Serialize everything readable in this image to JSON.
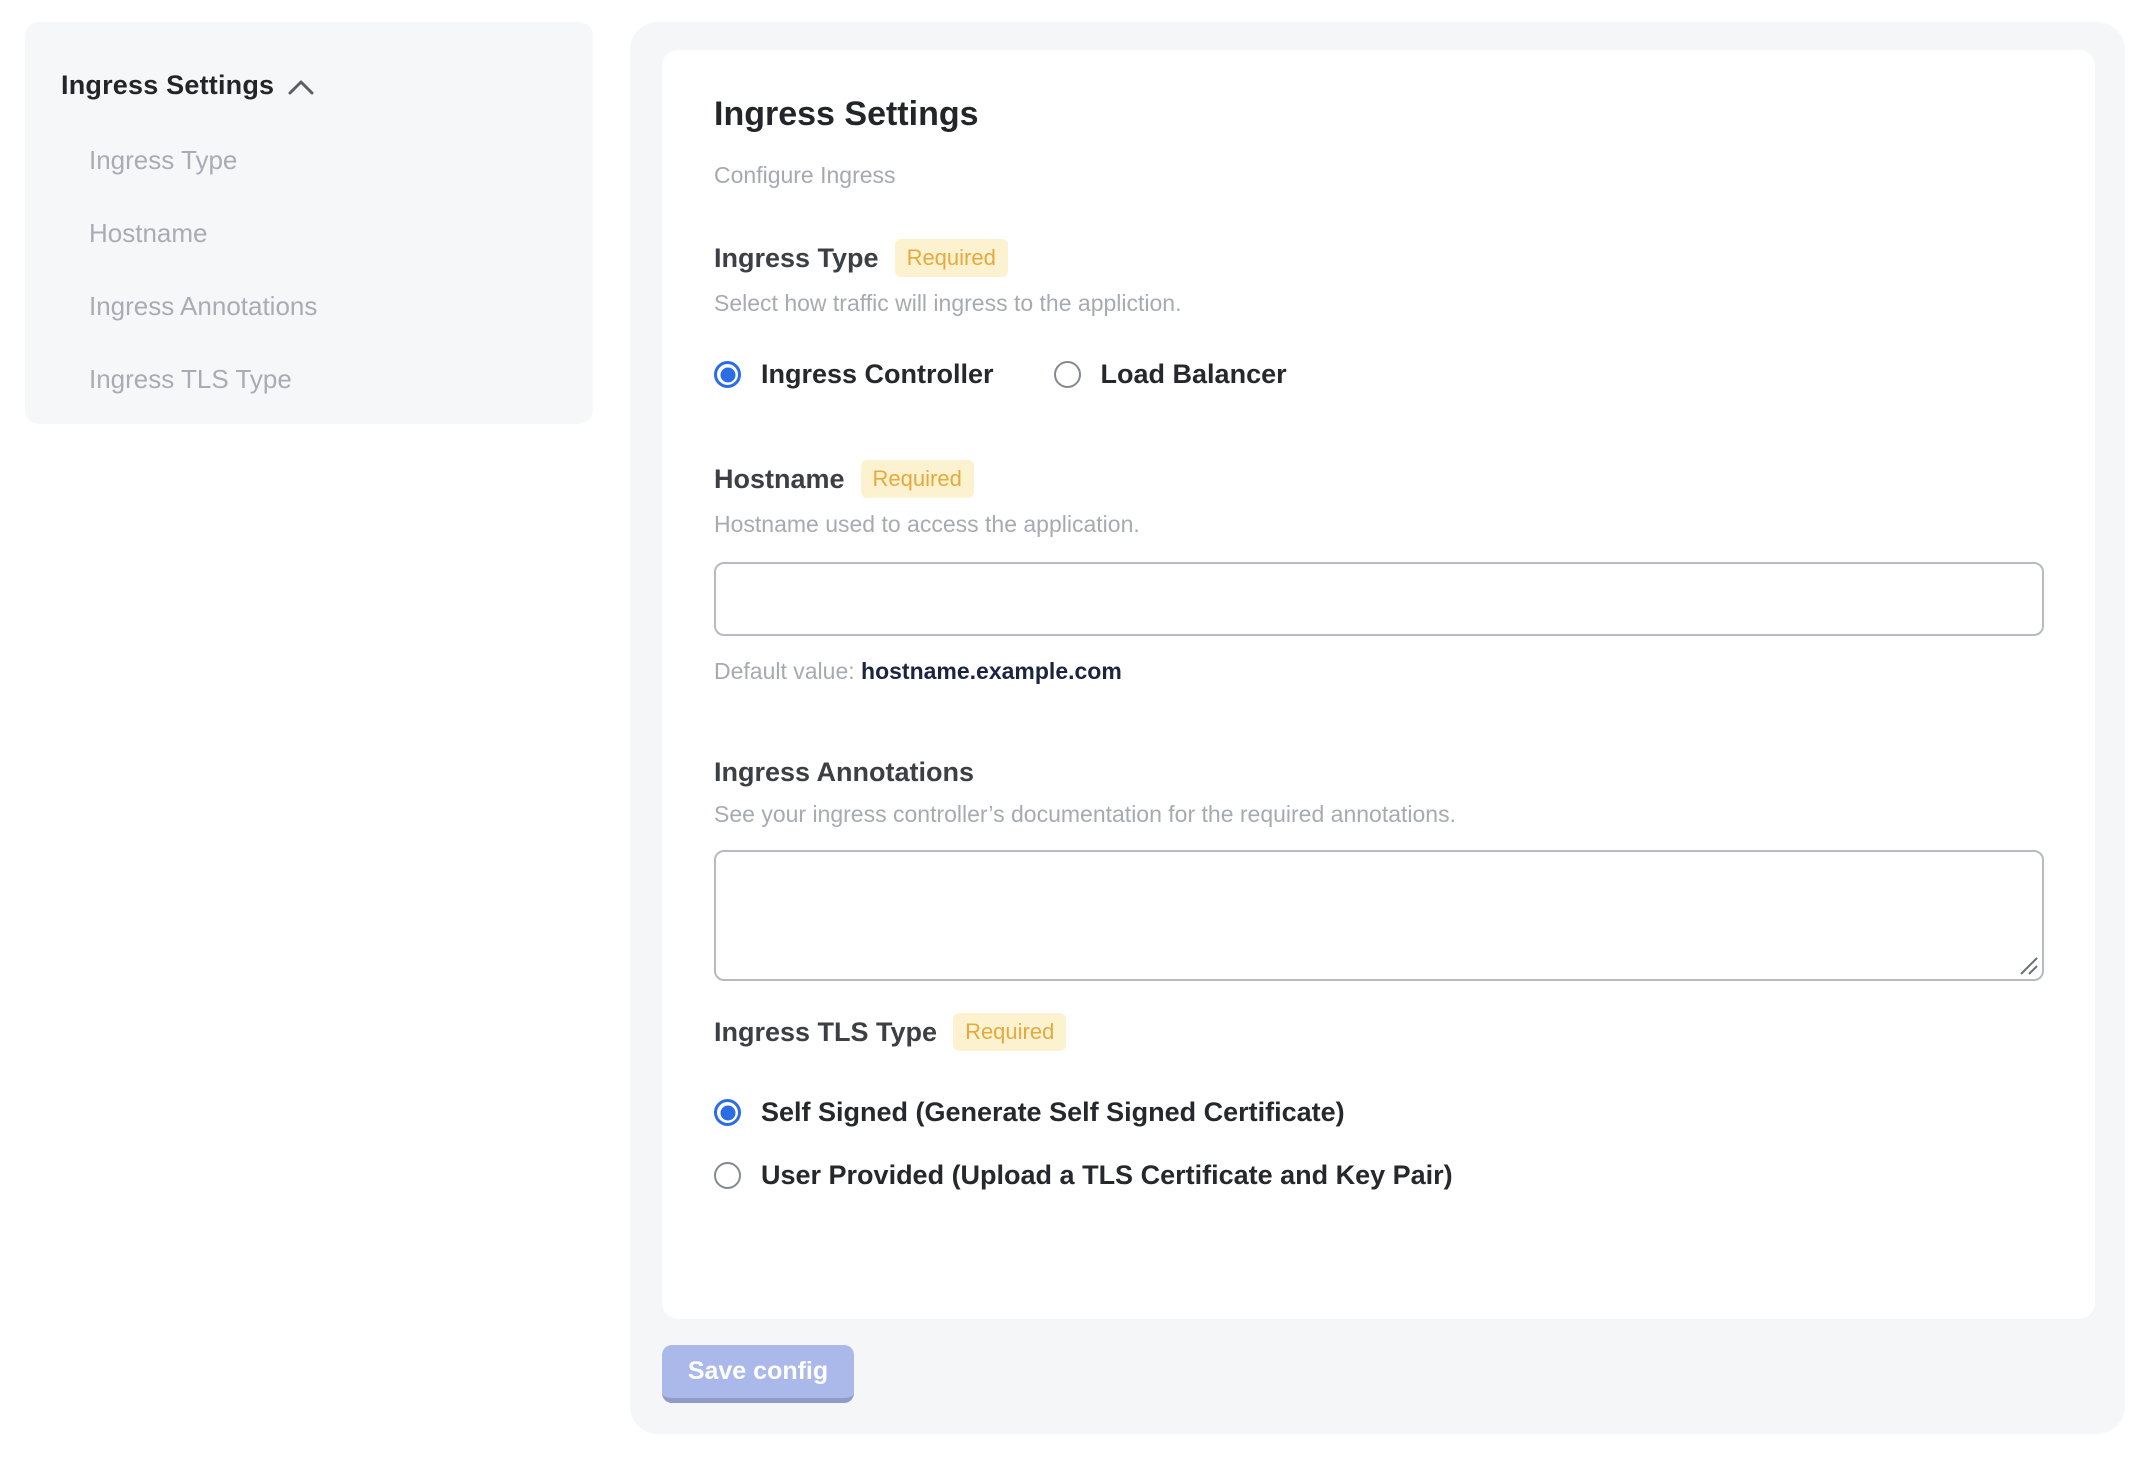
{
  "colors": {
    "accent_blue": "#2c6de6",
    "badge_bg": "#fdf2d0",
    "badge_text": "#e5a93e",
    "panel_bg": "#f5f6f8",
    "save_button_bg": "#aab8ea",
    "default_value_text": "#1b2440"
  },
  "sidebar": {
    "title": "Ingress Settings",
    "collapse_icon": "chevron-up-icon",
    "items": [
      {
        "label": "Ingress Type"
      },
      {
        "label": "Hostname"
      },
      {
        "label": "Ingress Annotations"
      },
      {
        "label": "Ingress TLS Type"
      }
    ]
  },
  "panel": {
    "title": "Ingress Settings",
    "subtitle": "Configure Ingress",
    "required_badge": "Required",
    "sections": {
      "ingress_type": {
        "label": "Ingress Type",
        "description": "Select how traffic will ingress to the appliction.",
        "options": [
          {
            "label": "Ingress Controller",
            "selected": true
          },
          {
            "label": "Load Balancer",
            "selected": false
          }
        ]
      },
      "hostname": {
        "label": "Hostname",
        "description": "Hostname used to access the application.",
        "value": "",
        "default_prefix": "Default value:",
        "default_value": "hostname.example.com"
      },
      "annotations": {
        "label": "Ingress Annotations",
        "description": "See your ingress controller’s documentation for the required annotations.",
        "value": ""
      },
      "tls_type": {
        "label": "Ingress TLS Type",
        "options": [
          {
            "label": "Self Signed (Generate Self Signed Certificate)",
            "selected": true
          },
          {
            "label": "User Provided (Upload a TLS Certificate and Key Pair)",
            "selected": false
          }
        ]
      }
    }
  },
  "footer": {
    "save_label": "Save config"
  }
}
